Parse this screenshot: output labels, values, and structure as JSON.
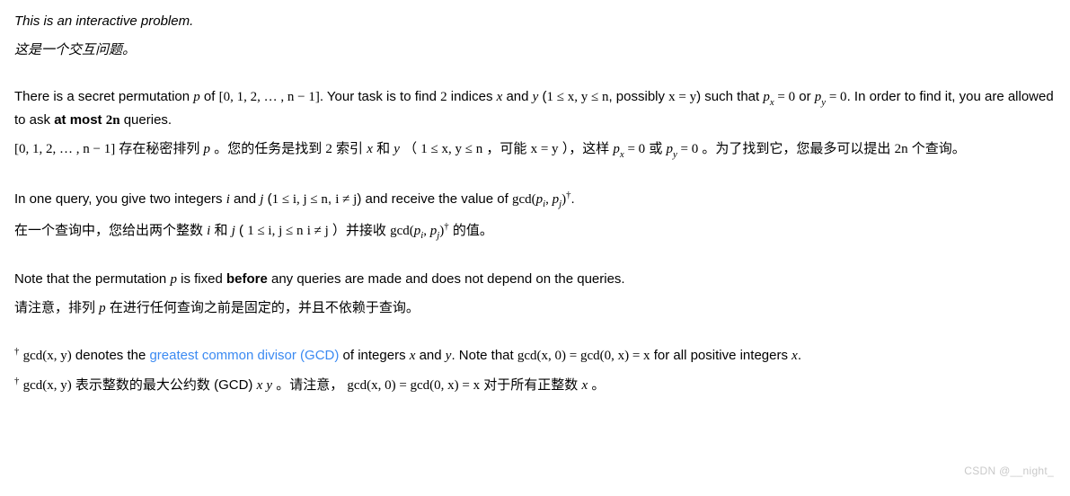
{
  "p1_en": "This is an interactive problem.",
  "p1_zh": "这是一个交互问题。",
  "p2_en_a": "There is a secret permutation ",
  "p2_en_b": " of ",
  "p2_en_c": ". Your task is to find ",
  "p2_en_d": " indices ",
  "p2_en_e": " and ",
  "p2_en_f": " (",
  "p2_en_g": ", possibly ",
  "p2_en_h": ") such that ",
  "p2_en_i": " or ",
  "p2_en_j": ". In order to find it, you are allowed to ask ",
  "p2_en_k": "at most ",
  "p2_en_l": " queries.",
  "p2_zh_a": " 存在秘密排列 ",
  "p2_zh_b": " 。您的任务是找到 ",
  "p2_zh_c": " 索引 ",
  "p2_zh_d": " 和 ",
  "p2_zh_e": " （ ",
  "p2_zh_f": " ，可能 ",
  "p2_zh_g": " ），这样 ",
  "p2_zh_h": " 或 ",
  "p2_zh_i": " 。为了找到它，您最多可以提出 ",
  "p2_zh_j": " 个查询。",
  "p3_en_a": "In one query, you give two integers ",
  "p3_en_b": " and ",
  "p3_en_c": " (",
  "p3_en_d": ", ",
  "p3_en_e": ") and receive the value of ",
  "p3_en_f": ".",
  "p3_zh_a": "在一个查询中，您给出两个整数 ",
  "p3_zh_b": " 和 ",
  "p3_zh_c": " ( ",
  "p3_zh_d": " ",
  "p3_zh_e": " ）并接收 ",
  "p3_zh_f": " 的值。",
  "p4_en_a": "Note that the permutation ",
  "p4_en_b": " is fixed ",
  "p4_en_c": "before",
  "p4_en_d": " any queries are made and does not depend on the queries.",
  "p4_zh_a": "请注意，排列 ",
  "p4_zh_b": " 在进行任何查询之前是固定的，并且不依赖于查询。",
  "p5_en_a": " denotes the ",
  "p5_en_link": "greatest common divisor (GCD)",
  "p5_en_b": " of integers ",
  "p5_en_c": " and ",
  "p5_en_d": ". Note that ",
  "p5_en_e": " for all positive integers ",
  "p5_en_f": ".",
  "p5_zh_a": " 表示整数的最大公约数 (GCD) ",
  "p5_zh_b": " 。请注意，",
  "p5_zh_c": " 对于所有正整数 ",
  "p5_zh_d": " 。",
  "m_p": "p",
  "m_range": "[0, 1, 2, … , n − 1]",
  "m_two": "2",
  "m_x": "x",
  "m_y": "y",
  "m_xy_bound": "1 ≤ x, y ≤ n",
  "m_ij_bound": "1 ≤ i, j ≤ n",
  "m_xeqy": "x = y",
  "m_pxeq0": " = 0",
  "m_pyeq0": " = 0",
  "m_2n": "2n",
  "m_i": "i",
  "m_j": "j",
  "m_ineqj": "i ≠ j",
  "m_gcd_pipj": "gcd(",
  "m_close": ")",
  "m_dagger": "†",
  "m_comma": ", ",
  "m_gcd_xy": "gcd(x, y)",
  "m_eqchain": "gcd(x, 0) = gcd(0, x) = x",
  "m_xy_between": " ",
  "m_py": "p",
  "m_px": "p",
  "watermark": "CSDN @__night_"
}
